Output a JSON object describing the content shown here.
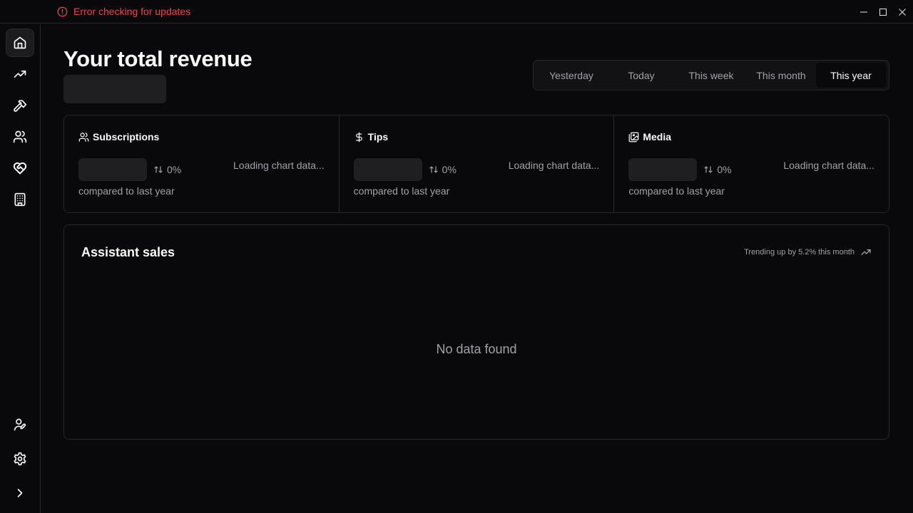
{
  "titlebar": {
    "update_error": "Error checking for updates",
    "error_color": "#ef4444"
  },
  "sidebar": {
    "items": [
      {
        "name": "home",
        "icon": "home-icon",
        "active": true
      },
      {
        "name": "trending",
        "icon": "trending-up-icon",
        "active": false
      },
      {
        "name": "tools",
        "icon": "hammer-icon",
        "active": false
      },
      {
        "name": "users",
        "icon": "users-icon",
        "active": false
      },
      {
        "name": "health",
        "icon": "heart-handshake-icon",
        "active": false
      },
      {
        "name": "building",
        "icon": "building-icon",
        "active": false
      }
    ],
    "bottom_items": [
      {
        "name": "profile",
        "icon": "user-pen-icon"
      },
      {
        "name": "settings",
        "icon": "gear-icon"
      },
      {
        "name": "expand",
        "icon": "chevron-right-icon"
      }
    ]
  },
  "main": {
    "title": "Your total revenue",
    "tabs": [
      {
        "label": "Yesterday",
        "active": false
      },
      {
        "label": "Today",
        "active": false
      },
      {
        "label": "This week",
        "active": false
      },
      {
        "label": "This month",
        "active": false
      },
      {
        "label": "This year",
        "active": true
      }
    ],
    "stats": [
      {
        "label": "Subscriptions",
        "icon": "users-icon",
        "change": "0%",
        "compare": "compared to last year",
        "chart_status": "Loading chart data..."
      },
      {
        "label": "Tips",
        "icon": "dollar-icon",
        "change": "0%",
        "compare": "compared to last year",
        "chart_status": "Loading chart data..."
      },
      {
        "label": "Media",
        "icon": "images-icon",
        "change": "0%",
        "compare": "compared to last year",
        "chart_status": "Loading chart data..."
      }
    ],
    "sales": {
      "title": "Assistant sales",
      "trend": "Trending up by 5.2% this month",
      "empty": "No data found"
    }
  }
}
